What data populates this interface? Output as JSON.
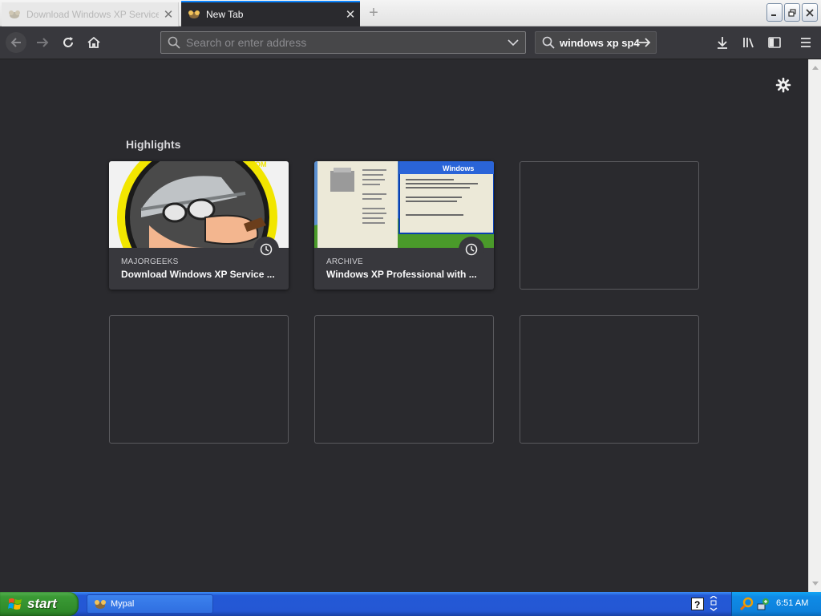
{
  "tabs": [
    {
      "title": "Download Windows XP Service P...",
      "state": "inactive"
    },
    {
      "title": "New Tab",
      "state": "active"
    }
  ],
  "toolbar": {
    "url_placeholder": "Search or enter address",
    "search_text": "windows xp sp4"
  },
  "content": {
    "section_title": "Highlights",
    "highlights": [
      {
        "host": "MAJORGEEKS",
        "title": "Download Windows XP Service ...",
        "icon": "clock-icon"
      },
      {
        "host": "ARCHIVE",
        "title": "Windows XP Professional with ...",
        "icon": "clock-icon"
      }
    ],
    "background": "#2a2a2e"
  },
  "taskbar": {
    "start_label": "start",
    "task": "Mypal",
    "time": "6:51 AM"
  },
  "colors": {
    "accent": "#0a84ff",
    "toolbar": "#38383d",
    "start_green": "#3a9a35",
    "taskbar_blue": "#2457d4"
  }
}
